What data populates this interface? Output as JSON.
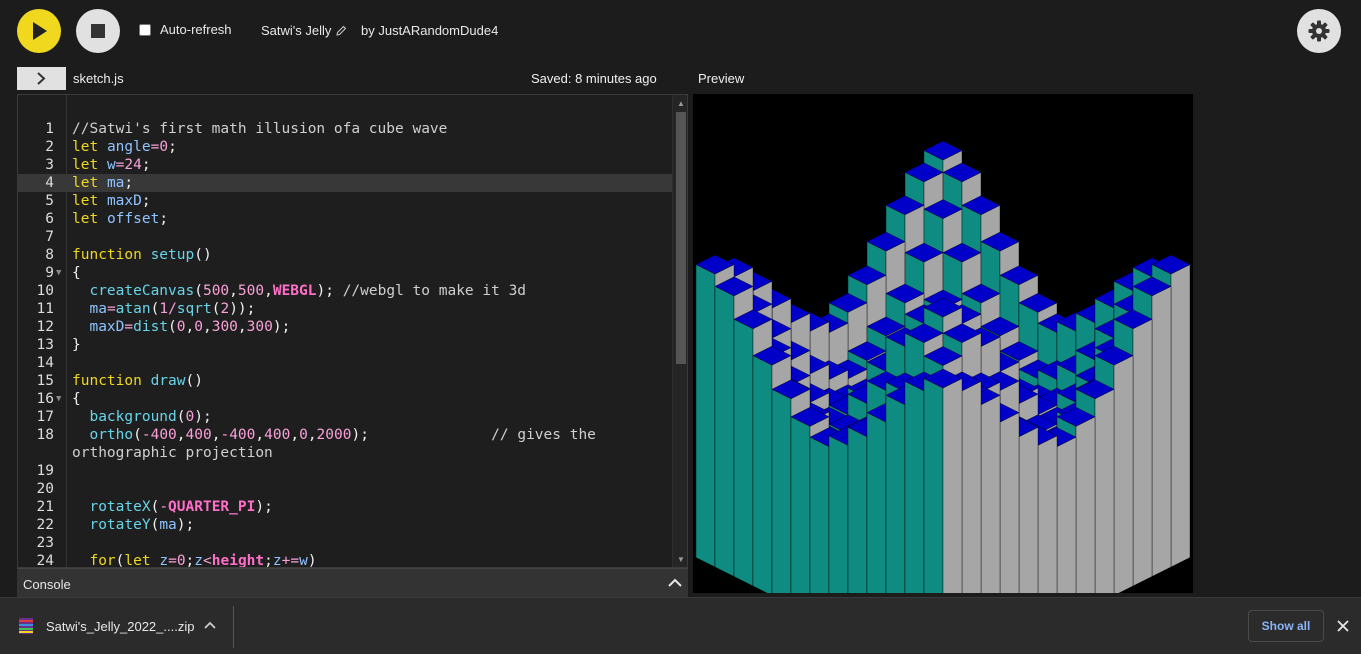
{
  "toolbar": {
    "play_icon": "play-icon",
    "stop_icon": "stop-icon",
    "auto_refresh_label": "Auto-refresh",
    "auto_refresh_checked": false,
    "sketch_name": "Satwi's Jelly",
    "author": "by JustARandomDude4",
    "settings_icon": "gear-icon"
  },
  "editor": {
    "file_name": "sketch.js",
    "saved_status": "Saved: 8 minutes ago",
    "lines": [
      {
        "n": "1",
        "code": "//Satwi's first math illusion ofa cube wave"
      },
      {
        "n": "2",
        "code": "let angle=0;"
      },
      {
        "n": "3",
        "code": "let w=24;"
      },
      {
        "n": "4",
        "code": "let ma;"
      },
      {
        "n": "5",
        "code": "let maxD;"
      },
      {
        "n": "6",
        "code": "let offset;"
      },
      {
        "n": "7",
        "code": ""
      },
      {
        "n": "8",
        "code": "function setup()"
      },
      {
        "n": "9",
        "code": "{"
      },
      {
        "n": "10",
        "code": "  createCanvas(500,500,WEBGL); //webgl to make it 3d"
      },
      {
        "n": "11",
        "code": "  ma=atan(1/sqrt(2));"
      },
      {
        "n": "12",
        "code": "  maxD=dist(0,0,300,300);"
      },
      {
        "n": "13",
        "code": "}"
      },
      {
        "n": "14",
        "code": ""
      },
      {
        "n": "15",
        "code": "function draw()"
      },
      {
        "n": "16",
        "code": "{"
      },
      {
        "n": "17",
        "code": "  background(0);"
      },
      {
        "n": "18",
        "code": "  ortho(-400,400,-400,400,0,2000);              // gives the orthographic projection"
      },
      {
        "n": "19",
        "code": ""
      },
      {
        "n": "20",
        "code": ""
      },
      {
        "n": "21",
        "code": "  rotateX(-QUARTER_PI);"
      },
      {
        "n": "22",
        "code": "  rotateY(ma);"
      },
      {
        "n": "23",
        "code": ""
      },
      {
        "n": "24",
        "code": "  for(let z=0;z<height;z+=w)"
      }
    ]
  },
  "preview": {
    "label": "Preview"
  },
  "console": {
    "label": "Console"
  },
  "download_bar": {
    "file_name": "Satwi's_Jelly_2022_....zip",
    "show_all": "Show all"
  },
  "colors": {
    "play": "#f0d81e",
    "cube_top": "#0000c8",
    "cube_left": "#0f8c82",
    "cube_right": "#a6a6a6",
    "link": "#8ab4f8"
  }
}
